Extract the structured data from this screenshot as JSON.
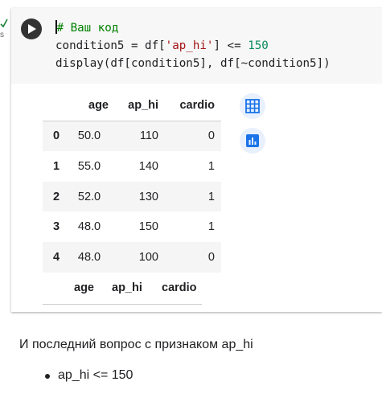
{
  "cell": {
    "run_status_text": "s",
    "code_lines": [
      {
        "parts": [
          {
            "t": "# Ваш код",
            "c": "comment"
          }
        ]
      },
      {
        "parts": [
          {
            "t": "condition5 = df[",
            "c": ""
          },
          {
            "t": "'ap_hi'",
            "c": "str"
          },
          {
            "t": "] <= ",
            "c": ""
          },
          {
            "t": "150",
            "c": "num"
          }
        ]
      },
      {
        "parts": [
          {
            "t": "display(df[condition5], df[~condition5])",
            "c": ""
          }
        ]
      }
    ]
  },
  "output": {
    "table1": {
      "columns": [
        "age",
        "ap_hi",
        "cardio"
      ],
      "rows": [
        {
          "index": "0",
          "age": "50.0",
          "ap_hi": "110",
          "cardio": "0"
        },
        {
          "index": "1",
          "age": "55.0",
          "ap_hi": "140",
          "cardio": "1"
        },
        {
          "index": "2",
          "age": "52.0",
          "ap_hi": "130",
          "cardio": "1"
        },
        {
          "index": "3",
          "age": "48.0",
          "ap_hi": "150",
          "cardio": "1"
        },
        {
          "index": "4",
          "age": "48.0",
          "ap_hi": "100",
          "cardio": "0"
        }
      ]
    },
    "table2": {
      "columns": [
        "age",
        "ap_hi",
        "cardio"
      ]
    },
    "icons": [
      "table-icon",
      "chart-icon"
    ],
    "accent_color": "#1a73e8"
  },
  "text": {
    "paragraph": "И последний вопрос с признаком ap_hi",
    "bullets": [
      "ap_hi <= 150"
    ]
  }
}
